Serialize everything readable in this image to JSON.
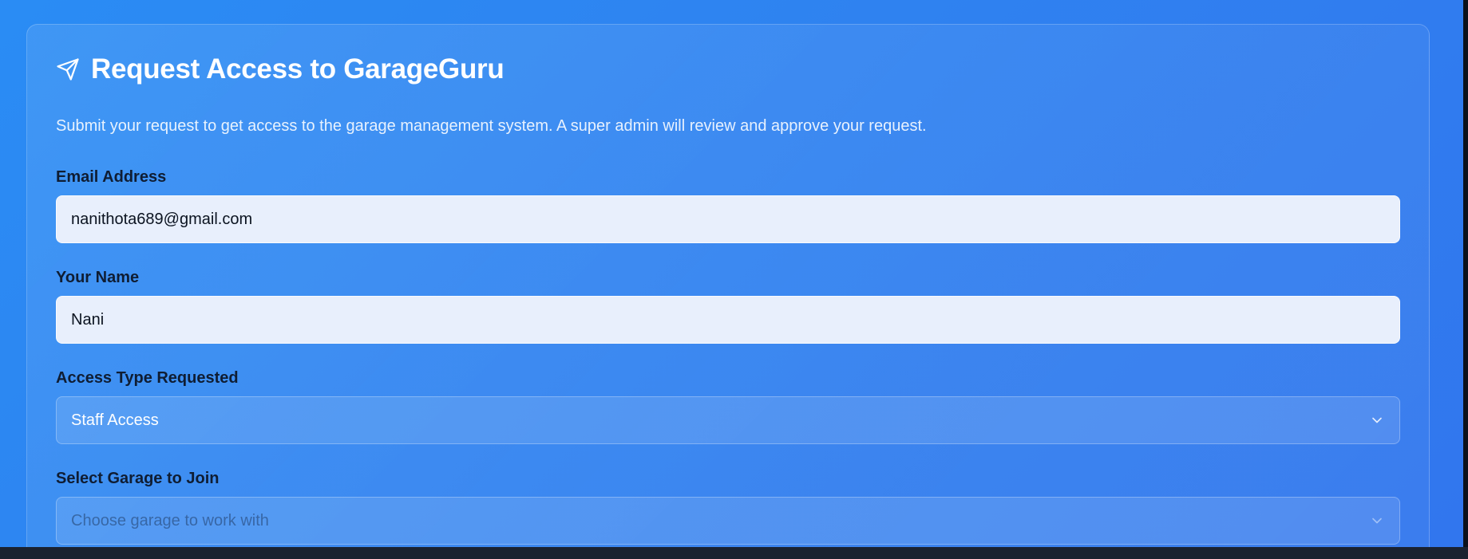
{
  "form": {
    "title": "Request Access to GarageGuru",
    "subtitle": "Submit your request to get access to the garage management system. A super admin will review and approve your request.",
    "title_icon": "send-icon",
    "email": {
      "label": "Email Address",
      "value": "nanithota689@gmail.com"
    },
    "name": {
      "label": "Your Name",
      "value": "Nani"
    },
    "access_type": {
      "label": "Access Type Requested",
      "selected": "Staff Access",
      "icon": "chevron-down-icon"
    },
    "garage": {
      "label": "Select Garage to Join",
      "placeholder": "Choose garage to work with",
      "icon": "chevron-down-icon"
    }
  },
  "colors": {
    "background": "#2f82f0",
    "title": "#ffffff",
    "label": "#0f1d33",
    "input_bg": "#e8effc"
  }
}
